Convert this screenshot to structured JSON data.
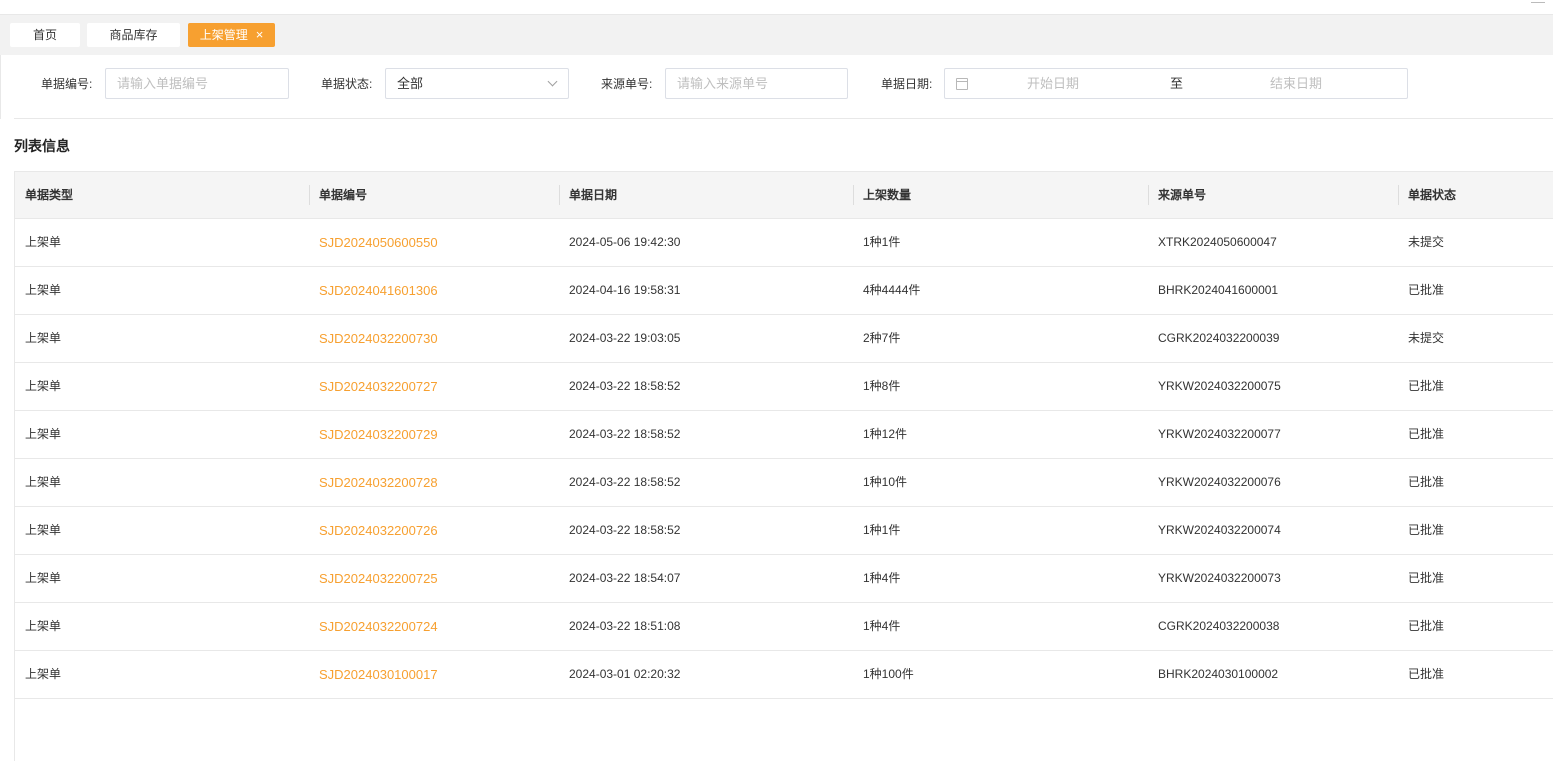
{
  "tabs": [
    {
      "label": "首页"
    },
    {
      "label": "商品库存"
    },
    {
      "label": "上架管理",
      "close": "×"
    }
  ],
  "filters": {
    "doc_no_label": "单据编号:",
    "doc_no_placeholder": "请输入单据编号",
    "status_label": "单据状态:",
    "status_value": "全部",
    "source_label": "来源单号:",
    "source_placeholder": "请输入来源单号",
    "date_label": "单据日期:",
    "date_start_placeholder": "开始日期",
    "date_separator": "至",
    "date_end_placeholder": "结束日期"
  },
  "section_title": "列表信息",
  "table": {
    "headers": [
      "单据类型",
      "单据编号",
      "单据日期",
      "上架数量",
      "来源单号",
      "单据状态"
    ],
    "rows": [
      {
        "type": "上架单",
        "no": "SJD2024050600550",
        "date": "2024-05-06 19:42:30",
        "qty": "1种1件",
        "source": "XTRK2024050600047",
        "status": "未提交"
      },
      {
        "type": "上架单",
        "no": "SJD2024041601306",
        "date": "2024-04-16 19:58:31",
        "qty": "4种4444件",
        "source": "BHRK2024041600001",
        "status": "已批准"
      },
      {
        "type": "上架单",
        "no": "SJD2024032200730",
        "date": "2024-03-22 19:03:05",
        "qty": "2种7件",
        "source": "CGRK2024032200039",
        "status": "未提交"
      },
      {
        "type": "上架单",
        "no": "SJD2024032200727",
        "date": "2024-03-22 18:58:52",
        "qty": "1种8件",
        "source": "YRKW2024032200075",
        "status": "已批准"
      },
      {
        "type": "上架单",
        "no": "SJD2024032200729",
        "date": "2024-03-22 18:58:52",
        "qty": "1种12件",
        "source": "YRKW2024032200077",
        "status": "已批准"
      },
      {
        "type": "上架单",
        "no": "SJD2024032200728",
        "date": "2024-03-22 18:58:52",
        "qty": "1种10件",
        "source": "YRKW2024032200076",
        "status": "已批准"
      },
      {
        "type": "上架单",
        "no": "SJD2024032200726",
        "date": "2024-03-22 18:58:52",
        "qty": "1种1件",
        "source": "YRKW2024032200074",
        "status": "已批准"
      },
      {
        "type": "上架单",
        "no": "SJD2024032200725",
        "date": "2024-03-22 18:54:07",
        "qty": "1种4件",
        "source": "YRKW2024032200073",
        "status": "已批准"
      },
      {
        "type": "上架单",
        "no": "SJD2024032200724",
        "date": "2024-03-22 18:51:08",
        "qty": "1种4件",
        "source": "CGRK2024032200038",
        "status": "已批准"
      },
      {
        "type": "上架单",
        "no": "SJD2024030100017",
        "date": "2024-03-01 02:20:32",
        "qty": "1种100件",
        "source": "BHRK2024030100002",
        "status": "已批准"
      }
    ]
  },
  "colors": {
    "accent": "#f7a030",
    "tabbar_bg": "#f2f2f2",
    "header_bg": "#f5f5f5",
    "border": "#e8e8e8"
  }
}
